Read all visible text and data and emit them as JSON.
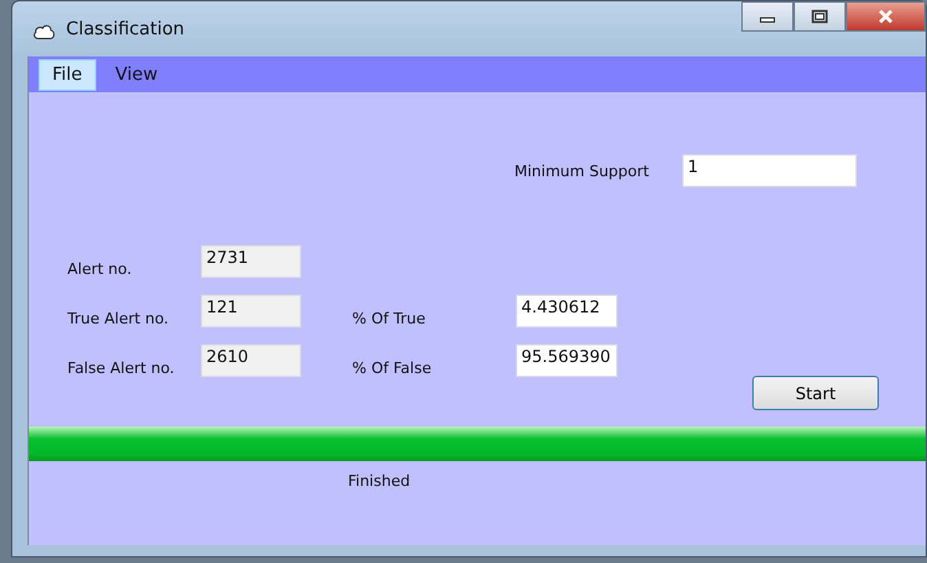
{
  "window": {
    "title": "Classification"
  },
  "menu": [
    {
      "label": "File",
      "selected": true
    },
    {
      "label": "View",
      "selected": false
    }
  ],
  "minimum_support": {
    "label": "Minimum Support",
    "value": "1"
  },
  "rows": [
    {
      "label": "Alert no.",
      "value": "2731"
    },
    {
      "label": "True Alert no.",
      "value": "121",
      "percent_label": "% Of True",
      "percent_value": "4.430612"
    },
    {
      "label": "False Alert no.",
      "value": "2610",
      "percent_label": "% Of False",
      "percent_value": "95.569390"
    }
  ],
  "start_button": "Start",
  "progress": {
    "level": 1
  },
  "status": "Finished"
}
